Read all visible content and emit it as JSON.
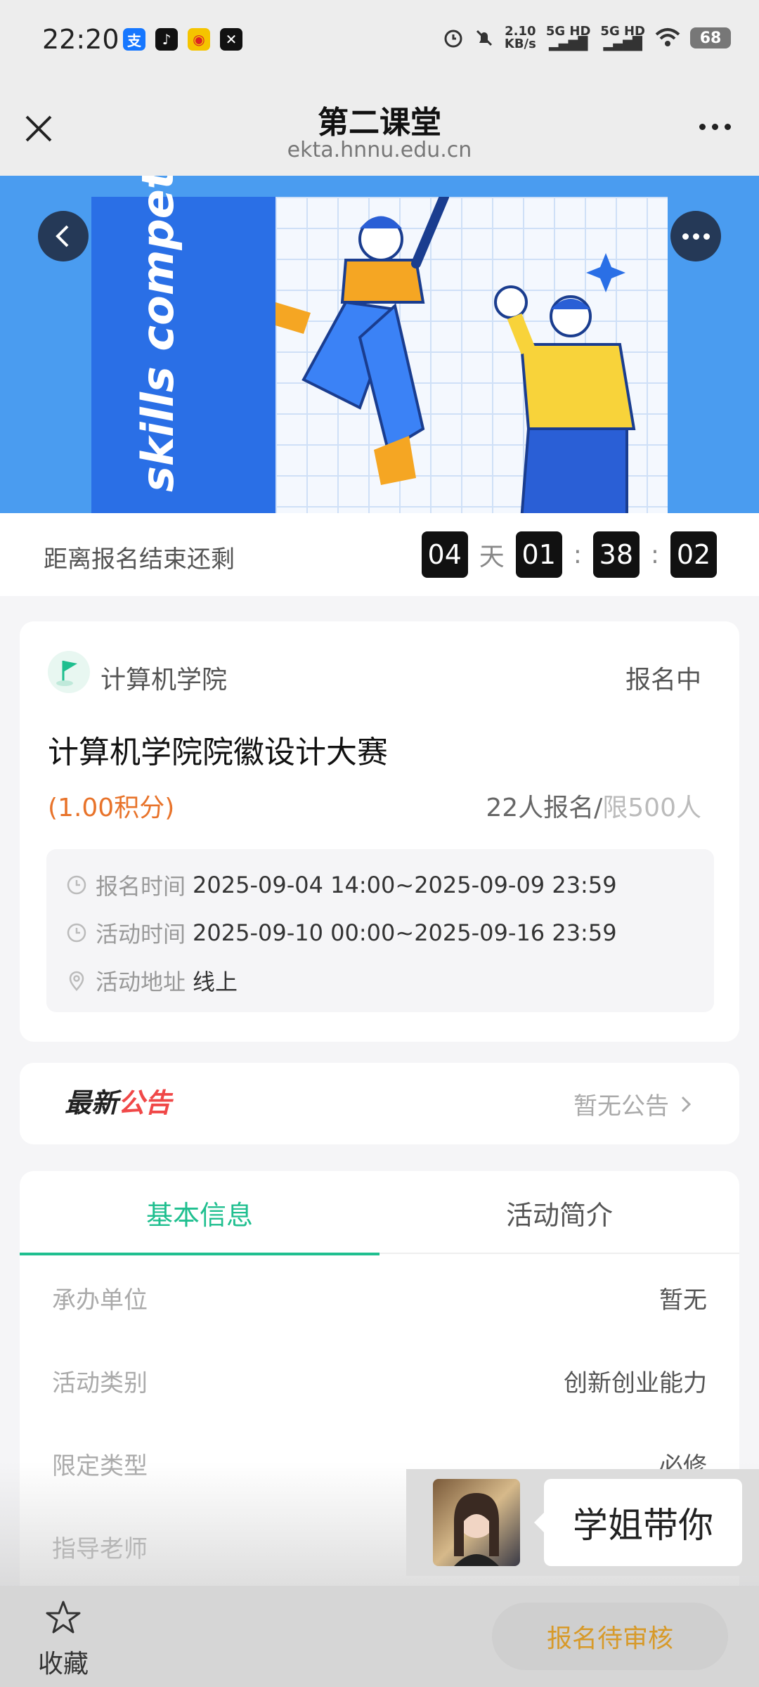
{
  "status_bar": {
    "time": "22:20",
    "app_icons": [
      "alipay-icon",
      "tiktok-icon",
      "weibo-icon",
      "capcut-icon"
    ],
    "net_speed_value": "2.10",
    "net_speed_unit": "KB/s",
    "signal_1": "5G HD",
    "signal_2": "5G HD",
    "battery": "68"
  },
  "nav": {
    "title": "第二课堂",
    "url": "ekta.hnnu.edu.cn"
  },
  "banner": {
    "text": "skills competition",
    "colors": {
      "bg": "#4a9cf0",
      "accent": "#2a6fe6"
    }
  },
  "countdown": {
    "label": "距离报名结束还剩",
    "days": "04",
    "day_unit": "天",
    "hours": "01",
    "minutes": "38",
    "seconds": "02",
    "sep": ":"
  },
  "activity": {
    "org": "计算机学院",
    "status": "报名中",
    "title": "计算机学院院徽设计大赛",
    "points": "(1.00积分)",
    "signup_count": "22人报名/",
    "signup_limit": "限500人",
    "details": [
      {
        "label": "报名时间",
        "value": "2025-09-04 14:00~2025-09-09 23:59"
      },
      {
        "label": "活动时间",
        "value": "2025-09-10 00:00~2025-09-16 23:59"
      },
      {
        "label": "活动地址",
        "value": "线上"
      }
    ]
  },
  "notice": {
    "logo_part1": "最新",
    "logo_part2": "公告",
    "text": "暂无公告"
  },
  "tabs": [
    {
      "label": "基本信息",
      "active": true
    },
    {
      "label": "活动简介",
      "active": false
    }
  ],
  "basic_info": [
    {
      "key": "承办单位",
      "value": "暂无"
    },
    {
      "key": "活动类别",
      "value": "创新创业能力"
    },
    {
      "key": "限定类型",
      "value": "必修"
    },
    {
      "key": "指导老师",
      "value": ""
    }
  ],
  "promo": {
    "text": "学姐带你"
  },
  "bottom": {
    "favorite_label": "收藏",
    "apply_label": "报名待审核"
  },
  "colors": {
    "accent_green": "#1fbf8f",
    "points_orange": "#e8732a",
    "notice_red": "#f04848",
    "apply_text": "#d79a2a"
  }
}
